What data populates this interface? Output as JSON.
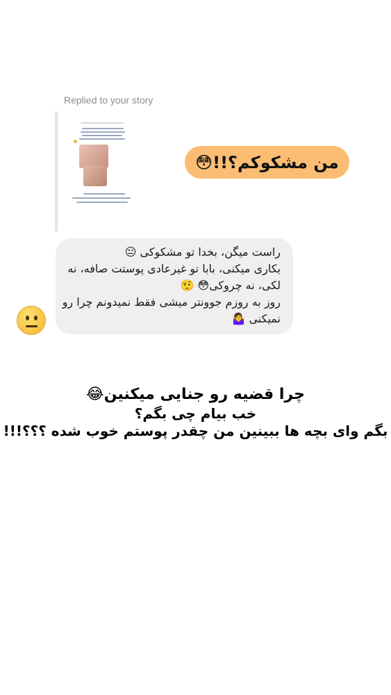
{
  "reply": {
    "label": "Replied to your story"
  },
  "story_preview": {
    "emoji_colors": [
      "#f2b33d"
    ]
  },
  "outgoing_message": {
    "text": "من مشکوکم؟!!😳",
    "bubble_color": "#fbbd73"
  },
  "incoming_message": {
    "lines": [
      "راست میگن، بخدا تو مشکوکی 😐",
      "یکاری میکنی، بابا تو غیرعادی پوستت صافه، نه",
      "لکی، نه چروکی😳 🤨",
      "روز به روزم جوونتر میشی فقط نمیدونم چرا رو",
      "نمیکنی 🤷‍♀️"
    ],
    "bubble_color": "#efefef"
  },
  "sender_avatar": {
    "icon": "neutral-face-emoji-icon"
  },
  "caption": {
    "line1": "چرا قضیه رو جنایی میکنین😂",
    "line2": "خب بیام چی بگم؟",
    "line3": "بگم وای بچه ها ببینین من چقدر پوستم خوب شده ؟؟؟!!!"
  }
}
